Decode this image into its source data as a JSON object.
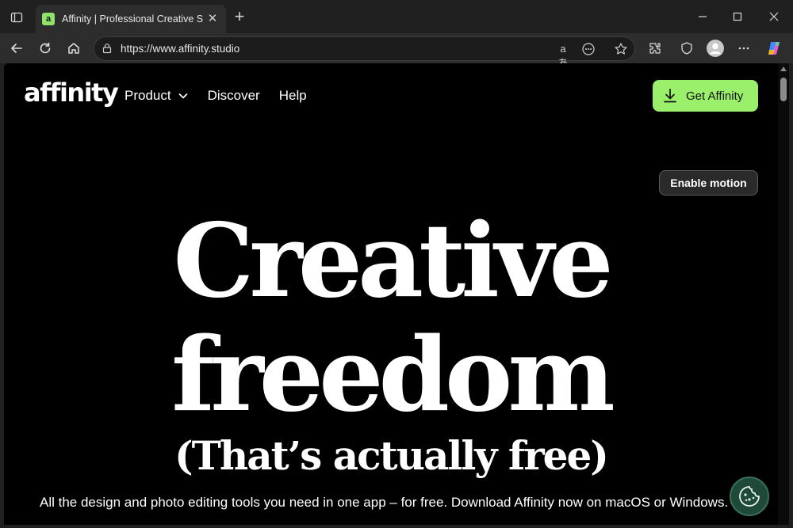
{
  "browser": {
    "tab": {
      "favicon_letter": "a",
      "title": "Affinity | Professional Creative Software"
    },
    "address": {
      "url": "https://www.affinity.studio"
    },
    "omnibox_icons": [
      "translate-icon",
      "more-options-icon",
      "favorite-star-icon"
    ],
    "toolbar_icons": [
      "extensions-icon",
      "shield-icon",
      "profile-avatar-icon",
      "menu-dots-icon",
      "copilot-icon"
    ]
  },
  "site": {
    "logo": "affinity",
    "nav": [
      {
        "label": "Product",
        "has_dropdown": true
      },
      {
        "label": "Discover"
      },
      {
        "label": "Help"
      }
    ],
    "cta_label": "Get Affinity",
    "motion_label": "Enable motion",
    "headline_line1": "Creative",
    "headline_line2": "freedom",
    "headline_line3": "(That’s actually free)",
    "subtitle": "All the design and photo editing tools you need in one app – for free. Download Affinity now on macOS or Windows."
  },
  "colors": {
    "accent_green": "#9af06a",
    "page_bg": "#000000",
    "cookie_bg": "#1f4a3a"
  }
}
